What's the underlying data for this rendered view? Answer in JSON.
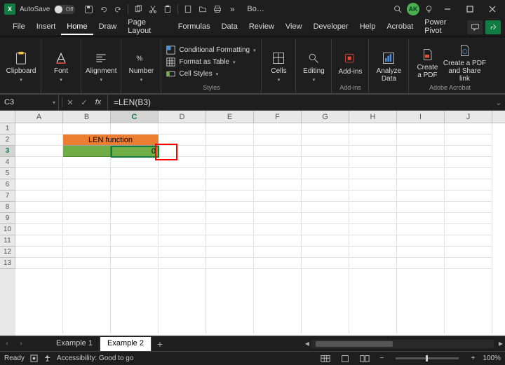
{
  "titlebar": {
    "app_initial": "X",
    "autosave_label": "AutoSave",
    "autosave_state": "Off",
    "doc_name": "Bo…",
    "avatar": "AK"
  },
  "ribbon": {
    "tabs": [
      "File",
      "Insert",
      "Home",
      "Draw",
      "Page Layout",
      "Formulas",
      "Data",
      "Review",
      "View",
      "Developer",
      "Help",
      "Acrobat",
      "Power Pivot"
    ],
    "active_tab": 2,
    "groups": {
      "clipboard": {
        "label": "Clipboard"
      },
      "font": {
        "label": "Font"
      },
      "alignment": {
        "label": "Alignment"
      },
      "number": {
        "label": "Number"
      },
      "styles": {
        "label": "Styles",
        "items": [
          "Conditional Formatting",
          "Format as Table",
          "Cell Styles"
        ]
      },
      "cells": {
        "label": "Cells"
      },
      "editing": {
        "label": "Editing"
      },
      "addins": {
        "label": "Add-ins",
        "btn": "Add-ins"
      },
      "analyze": {
        "label": "Analyze Data",
        "btn": "Analyze Data"
      },
      "acrobat": {
        "label": "Adobe Acrobat",
        "btn1": "Create a PDF",
        "btn2": "Create a PDF and Share link"
      }
    }
  },
  "formulabar": {
    "namebox": "C3",
    "fx_label": "fx",
    "formula": "=LEN(B3)"
  },
  "grid": {
    "columns": [
      "A",
      "B",
      "C",
      "D",
      "E",
      "F",
      "G",
      "H",
      "I",
      "J"
    ],
    "selected_col": "C",
    "rows": [
      1,
      2,
      3,
      4,
      5,
      6,
      7,
      8,
      9,
      10,
      11,
      12,
      13
    ],
    "selected_row": 3,
    "merged": {
      "text": "LEN function"
    },
    "c3_value": "0"
  },
  "tabs_bar": {
    "sheets": [
      "Example 1",
      "Example 2"
    ],
    "active": 1
  },
  "statusbar": {
    "ready": "Ready",
    "accessibility": "Accessibility: Good to go",
    "zoom": "100%"
  }
}
